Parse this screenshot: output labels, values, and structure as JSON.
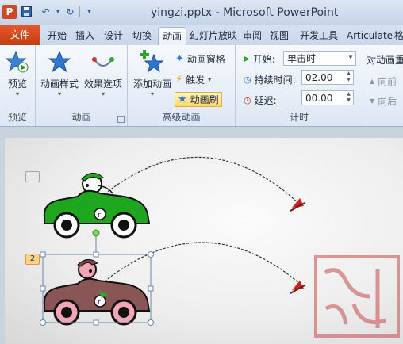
{
  "window": {
    "title": "yingzi.pptx - Microsoft PowerPoint",
    "app_icon": "P"
  },
  "tabs": [
    {
      "label": "文件"
    },
    {
      "label": "开始"
    },
    {
      "label": "插入"
    },
    {
      "label": "设计"
    },
    {
      "label": "切换"
    },
    {
      "label": "动画"
    },
    {
      "label": "幻灯片放映"
    },
    {
      "label": "审阅"
    },
    {
      "label": "视图"
    },
    {
      "label": "开发工具"
    },
    {
      "label": "Articulate"
    },
    {
      "label": "格"
    }
  ],
  "active_tab": "动画",
  "ribbon": {
    "preview": {
      "button": "预览",
      "group": "预览"
    },
    "animation": {
      "style_button": "动画样式",
      "effect_button": "效果选项",
      "group": "动画"
    },
    "advanced": {
      "add_button": "添加动画",
      "pane_button": "动画窗格",
      "trigger_button": "触发",
      "painter_button": "动画刷",
      "group": "高级动画"
    },
    "timing": {
      "start_label": "开始:",
      "start_value": "单击时",
      "duration_label": "持续时间:",
      "duration_value": "02.00",
      "delay_label": "延迟:",
      "delay_value": "00.00",
      "group": "计时"
    },
    "reorder": {
      "title": "对动画重",
      "forward": "向前",
      "backward": "向后"
    }
  },
  "slide": {
    "badge_1": "",
    "badge_2": "2"
  },
  "colors": {
    "accent": "#2e6db4",
    "file_tab": "#d24726",
    "car_green": "#1fa61f",
    "car_shadow": "#7a4747",
    "flag_red": "#d12222",
    "stamp_red": "#c74a4a"
  }
}
